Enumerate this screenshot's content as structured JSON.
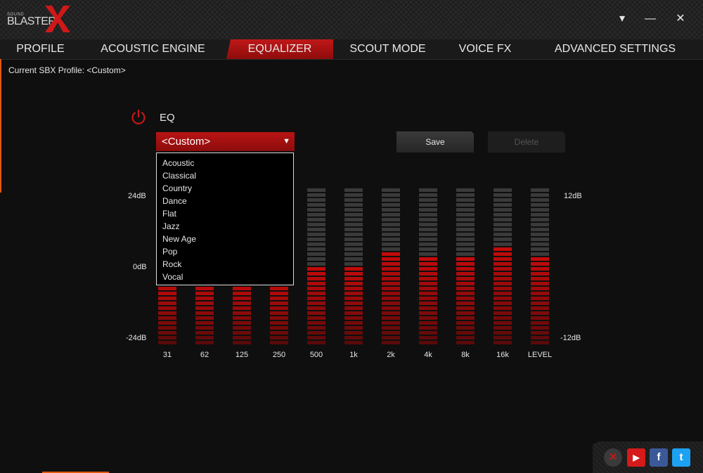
{
  "app": {
    "logo_small": "SOUND",
    "logo_text": "BLASTER"
  },
  "window": {
    "minimize_glyph": "▾",
    "minimize_bar": "—",
    "close_glyph": "✕"
  },
  "tabs": [
    {
      "label": "PROFILE",
      "active": false
    },
    {
      "label": "ACOUSTIC ENGINE",
      "active": false
    },
    {
      "label": "EQUALIZER",
      "active": true
    },
    {
      "label": "SCOUT MODE",
      "active": false
    },
    {
      "label": "VOICE FX",
      "active": false
    },
    {
      "label": "ADVANCED SETTINGS",
      "active": false
    }
  ],
  "profile": {
    "text": "Current SBX Profile: <Custom>"
  },
  "eq": {
    "label": "EQ",
    "selected_preset": "<Custom>",
    "presets": [
      "Acoustic",
      "Classical",
      "Country",
      "Dance",
      "Flat",
      "Jazz",
      "New Age",
      "Pop",
      "Rock",
      "Vocal"
    ],
    "save_label": "Save",
    "delete_label": "Delete",
    "left_scale": {
      "top": "24dB",
      "mid": "0dB",
      "bottom": "-24dB"
    },
    "right_scale": {
      "top": "12dB",
      "bottom": "-12dB"
    },
    "bands": [
      {
        "freq": "31",
        "level": 0.4
      },
      {
        "freq": "62",
        "level": 0.4
      },
      {
        "freq": "125",
        "level": 0.4
      },
      {
        "freq": "250",
        "level": 0.4
      },
      {
        "freq": "500",
        "level": 0.5
      },
      {
        "freq": "1k",
        "level": 0.5
      },
      {
        "freq": "2k",
        "level": 0.6
      },
      {
        "freq": "4k",
        "level": 0.55
      },
      {
        "freq": "8k",
        "level": 0.55
      },
      {
        "freq": "16k",
        "level": 0.62
      },
      {
        "freq": "LEVEL",
        "level": 0.55
      }
    ]
  },
  "colors": {
    "accent_red": "#c01818",
    "lit_segment": "#8a0c0c",
    "unlit_segment": "#3a3a3a",
    "orange_accent": "#e05a10"
  },
  "social": [
    {
      "name": "blasterx-icon",
      "glyph": "✕",
      "bg": "#3a3a3a"
    },
    {
      "name": "youtube-icon",
      "glyph": "▶",
      "bg": "#d41a1a"
    },
    {
      "name": "facebook-icon",
      "glyph": "f",
      "bg": "#3b5998"
    },
    {
      "name": "twitter-icon",
      "glyph": "t",
      "bg": "#1da1f2"
    }
  ]
}
